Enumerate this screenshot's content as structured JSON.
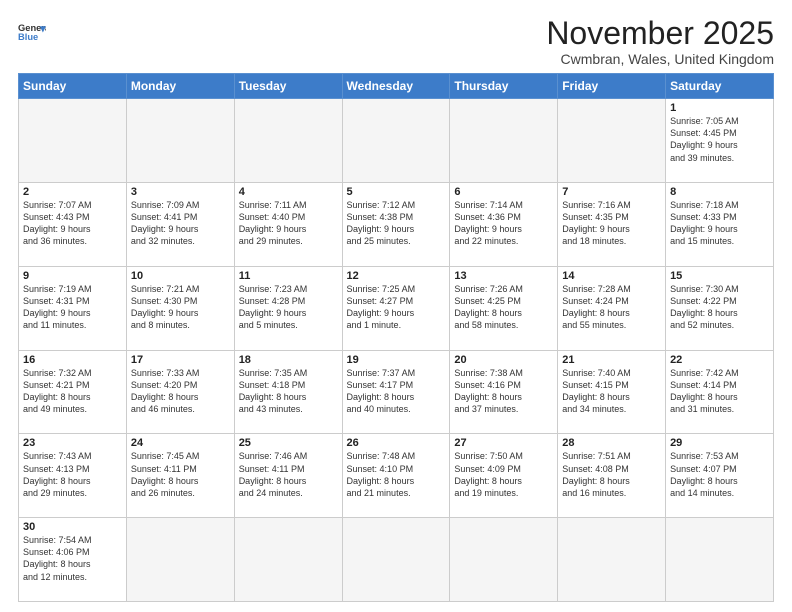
{
  "header": {
    "logo_line1": "General",
    "logo_line2": "Blue",
    "title": "November 2025",
    "subtitle": "Cwmbran, Wales, United Kingdom"
  },
  "days_of_week": [
    "Sunday",
    "Monday",
    "Tuesday",
    "Wednesday",
    "Thursday",
    "Friday",
    "Saturday"
  ],
  "weeks": [
    [
      {
        "num": "",
        "info": ""
      },
      {
        "num": "",
        "info": ""
      },
      {
        "num": "",
        "info": ""
      },
      {
        "num": "",
        "info": ""
      },
      {
        "num": "",
        "info": ""
      },
      {
        "num": "",
        "info": ""
      },
      {
        "num": "1",
        "info": "Sunrise: 7:05 AM\nSunset: 4:45 PM\nDaylight: 9 hours\nand 39 minutes."
      }
    ],
    [
      {
        "num": "2",
        "info": "Sunrise: 7:07 AM\nSunset: 4:43 PM\nDaylight: 9 hours\nand 36 minutes."
      },
      {
        "num": "3",
        "info": "Sunrise: 7:09 AM\nSunset: 4:41 PM\nDaylight: 9 hours\nand 32 minutes."
      },
      {
        "num": "4",
        "info": "Sunrise: 7:11 AM\nSunset: 4:40 PM\nDaylight: 9 hours\nand 29 minutes."
      },
      {
        "num": "5",
        "info": "Sunrise: 7:12 AM\nSunset: 4:38 PM\nDaylight: 9 hours\nand 25 minutes."
      },
      {
        "num": "6",
        "info": "Sunrise: 7:14 AM\nSunset: 4:36 PM\nDaylight: 9 hours\nand 22 minutes."
      },
      {
        "num": "7",
        "info": "Sunrise: 7:16 AM\nSunset: 4:35 PM\nDaylight: 9 hours\nand 18 minutes."
      },
      {
        "num": "8",
        "info": "Sunrise: 7:18 AM\nSunset: 4:33 PM\nDaylight: 9 hours\nand 15 minutes."
      }
    ],
    [
      {
        "num": "9",
        "info": "Sunrise: 7:19 AM\nSunset: 4:31 PM\nDaylight: 9 hours\nand 11 minutes."
      },
      {
        "num": "10",
        "info": "Sunrise: 7:21 AM\nSunset: 4:30 PM\nDaylight: 9 hours\nand 8 minutes."
      },
      {
        "num": "11",
        "info": "Sunrise: 7:23 AM\nSunset: 4:28 PM\nDaylight: 9 hours\nand 5 minutes."
      },
      {
        "num": "12",
        "info": "Sunrise: 7:25 AM\nSunset: 4:27 PM\nDaylight: 9 hours\nand 1 minute."
      },
      {
        "num": "13",
        "info": "Sunrise: 7:26 AM\nSunset: 4:25 PM\nDaylight: 8 hours\nand 58 minutes."
      },
      {
        "num": "14",
        "info": "Sunrise: 7:28 AM\nSunset: 4:24 PM\nDaylight: 8 hours\nand 55 minutes."
      },
      {
        "num": "15",
        "info": "Sunrise: 7:30 AM\nSunset: 4:22 PM\nDaylight: 8 hours\nand 52 minutes."
      }
    ],
    [
      {
        "num": "16",
        "info": "Sunrise: 7:32 AM\nSunset: 4:21 PM\nDaylight: 8 hours\nand 49 minutes."
      },
      {
        "num": "17",
        "info": "Sunrise: 7:33 AM\nSunset: 4:20 PM\nDaylight: 8 hours\nand 46 minutes."
      },
      {
        "num": "18",
        "info": "Sunrise: 7:35 AM\nSunset: 4:18 PM\nDaylight: 8 hours\nand 43 minutes."
      },
      {
        "num": "19",
        "info": "Sunrise: 7:37 AM\nSunset: 4:17 PM\nDaylight: 8 hours\nand 40 minutes."
      },
      {
        "num": "20",
        "info": "Sunrise: 7:38 AM\nSunset: 4:16 PM\nDaylight: 8 hours\nand 37 minutes."
      },
      {
        "num": "21",
        "info": "Sunrise: 7:40 AM\nSunset: 4:15 PM\nDaylight: 8 hours\nand 34 minutes."
      },
      {
        "num": "22",
        "info": "Sunrise: 7:42 AM\nSunset: 4:14 PM\nDaylight: 8 hours\nand 31 minutes."
      }
    ],
    [
      {
        "num": "23",
        "info": "Sunrise: 7:43 AM\nSunset: 4:13 PM\nDaylight: 8 hours\nand 29 minutes."
      },
      {
        "num": "24",
        "info": "Sunrise: 7:45 AM\nSunset: 4:11 PM\nDaylight: 8 hours\nand 26 minutes."
      },
      {
        "num": "25",
        "info": "Sunrise: 7:46 AM\nSunset: 4:11 PM\nDaylight: 8 hours\nand 24 minutes."
      },
      {
        "num": "26",
        "info": "Sunrise: 7:48 AM\nSunset: 4:10 PM\nDaylight: 8 hours\nand 21 minutes."
      },
      {
        "num": "27",
        "info": "Sunrise: 7:50 AM\nSunset: 4:09 PM\nDaylight: 8 hours\nand 19 minutes."
      },
      {
        "num": "28",
        "info": "Sunrise: 7:51 AM\nSunset: 4:08 PM\nDaylight: 8 hours\nand 16 minutes."
      },
      {
        "num": "29",
        "info": "Sunrise: 7:53 AM\nSunset: 4:07 PM\nDaylight: 8 hours\nand 14 minutes."
      }
    ],
    [
      {
        "num": "30",
        "info": "Sunrise: 7:54 AM\nSunset: 4:06 PM\nDaylight: 8 hours\nand 12 minutes."
      },
      {
        "num": "",
        "info": ""
      },
      {
        "num": "",
        "info": ""
      },
      {
        "num": "",
        "info": ""
      },
      {
        "num": "",
        "info": ""
      },
      {
        "num": "",
        "info": ""
      },
      {
        "num": "",
        "info": ""
      }
    ]
  ]
}
